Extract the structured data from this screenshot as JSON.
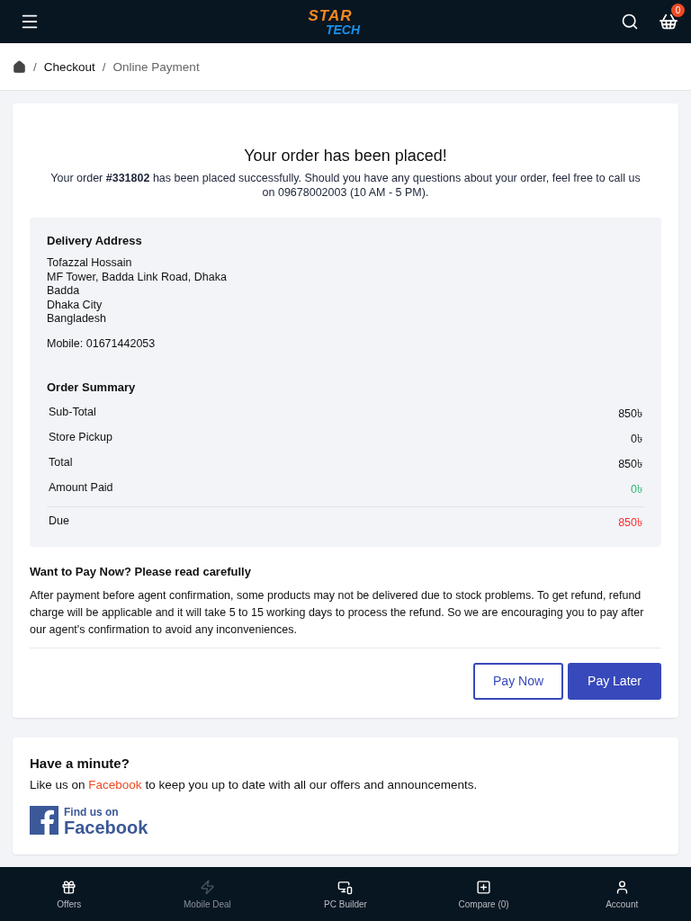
{
  "header": {
    "logo": {
      "word_1": "STAR",
      "word_2": "TECH"
    },
    "cart_count": "0"
  },
  "breadcrumb": [
    {
      "separator": "/",
      "label": "Checkout"
    },
    {
      "separator": "/",
      "label": "Online Payment"
    }
  ],
  "confirmation": {
    "title": "Your order has been placed!",
    "message": "Your order **#331802** has been placed successfully. Should you have any questions about your order, feel free to call us on 09678002003 (10 AM - 5 PM)."
  },
  "delivery_address": {
    "heading": "Delivery Address",
    "lines": [
      "Tofazzal Hossain",
      "MF Tower, Badda Link Road, Dhaka",
      "Badda",
      "Dhaka City",
      "Bangladesh"
    ],
    "mobile": "Mobile: 01671442053"
  },
  "order_summary": {
    "heading": "Order Summary",
    "rows": [
      {
        "label": "Sub-Total",
        "amount": "850৳"
      },
      {
        "label": "Store Pickup",
        "amount": "0৳"
      },
      {
        "label": "Total",
        "amount": "850৳"
      },
      {
        "label": "Amount Paid",
        "amount": "0৳",
        "color": "#2fb36d"
      },
      {
        "label": "Due",
        "amount": "850৳",
        "color": "#ff2a2a"
      }
    ]
  },
  "notice": {
    "heading": "Want to Pay Now? Please read carefully",
    "text": "After payment before agent confirmation, some products may not be delivered due to stock problems. To get refund, refund charge will be applicable and it will take 5 to 15 working days to process the refund. So we are encouraging you to pay after our agent's confirmation to avoid any inconveniences."
  },
  "buttons": [
    {
      "label": "Pay Now",
      "kind": "outline"
    },
    {
      "label": "Pay Later",
      "kind": "filled"
    }
  ],
  "social": {
    "heading": "Have a minute?",
    "text_before": "Like us on",
    "link": "Facebook",
    "text_after": "to keep you up to date with all our offers and announcements.",
    "badge_line_1": "Find us on",
    "badge_line_2": "Facebook"
  },
  "bottom_nav": [
    {
      "label": "Offers",
      "disabled": false
    },
    {
      "label": "Mobile Deal",
      "disabled": true
    },
    {
      "label": "PC Builder",
      "disabled": false
    },
    {
      "label": "Compare (0)",
      "disabled": false
    },
    {
      "label": "Account",
      "disabled": false
    }
  ]
}
